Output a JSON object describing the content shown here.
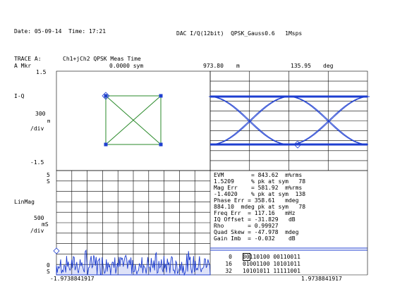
{
  "header": {
    "date_time": "Date: 05-09-14  Time: 17:21",
    "instrument": "DAC I/Q(12bit)  QPSK_Gauss0.6   1Msps"
  },
  "trace": {
    "label": "TRACE A:",
    "title": "Ch1+jCh2 QPSK Meas Time",
    "marker": "A Mkr",
    "marker_time": "0.0000 sym",
    "marker_mag": "973.80",
    "marker_mag_unit": "m",
    "marker_phase": "135.95",
    "marker_phase_unit": "deg"
  },
  "iq_panel": {
    "top_value": "1.5",
    "name": "I-Q",
    "scale": "300",
    "scale_unit": "m",
    "per_div": "/div",
    "bottom_value": "-1.5"
  },
  "mag_panel": {
    "top_value": "5",
    "top_unit": "S",
    "name": "LinMag",
    "scale": "500",
    "scale_unit": "mS",
    "per_div": "/div",
    "bottom_value": "0",
    "bottom_unit": "S",
    "x_start": "-1.9738841917",
    "x_end": "1.9738841917"
  },
  "measurements": [
    "EVM        = 843.62  m%rms",
    "1.5209     % pk at sym   78",
    "Mag Err    = 581.92  m%rms",
    "-1.4020    % pk at sym  138",
    "Phase Err = 358.61   mdeg",
    "884.10  mdeg pk at sym   78",
    "Freq Err  = 117.16   mHz",
    "IQ Offset = -31.829   dB",
    "Rho       = 0.99927",
    "Quad Skew = -47.978  mdeg",
    "Gain Imb  = -0.032    dB"
  ],
  "symbols": [
    {
      "index": "0",
      "bits": "00110100 00110011"
    },
    {
      "index": "16",
      "bits": "01001100 10101011"
    },
    {
      "index": "32",
      "bits": "10101011 11111001"
    }
  ],
  "colors": {
    "trace": "#1f3fd0",
    "constellation": "#2a8a2a",
    "grid": "#000000"
  }
}
